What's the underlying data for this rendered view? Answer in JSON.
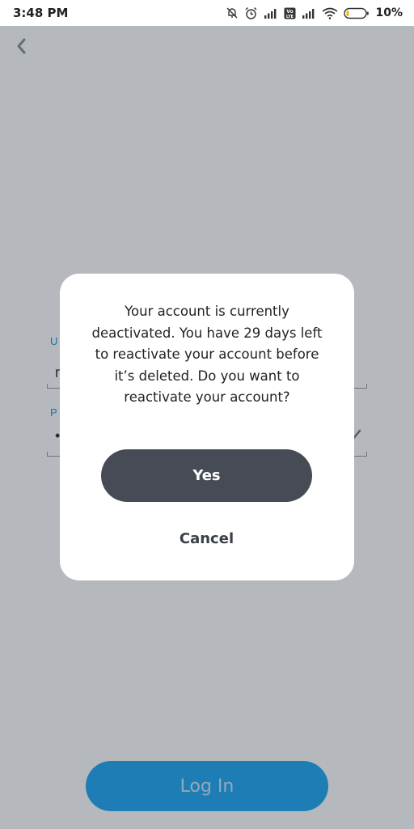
{
  "status_bar": {
    "time": "3:48 PM",
    "battery_percent": "10%",
    "icons": [
      "bell-off-icon",
      "alarm-icon",
      "signal-icon",
      "volte-icon",
      "signal-icon",
      "wifi-icon",
      "battery-icon"
    ]
  },
  "login": {
    "back_icon": "chevron-left-icon",
    "username_label": "U",
    "username_value": "r",
    "password_label": "P",
    "password_value": "•",
    "eye_icon": "eye-off-icon",
    "login_label": "Log In"
  },
  "dialog": {
    "message": "Your account is currently deactivated. You have 29 days left to reactivate your account before it’s deleted. Do you want to reactivate your account?",
    "yes_label": "Yes",
    "cancel_label": "Cancel"
  },
  "colors": {
    "accent": "#1fa8f5",
    "label_blue": "#0f9ee9",
    "primary_button": "#474b55"
  }
}
